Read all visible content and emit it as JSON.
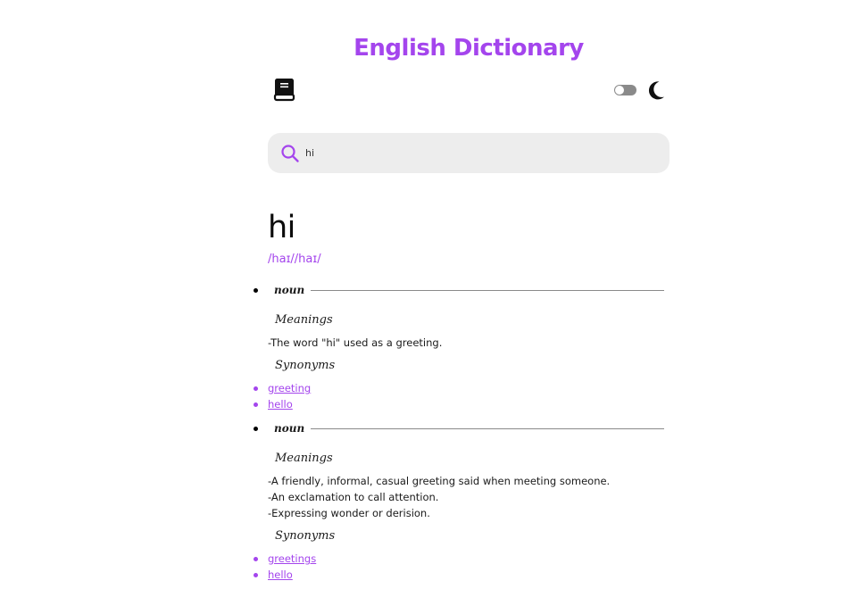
{
  "app": {
    "title": "English Dictionary"
  },
  "search": {
    "value": "hi",
    "icon": "search-icon"
  },
  "theme": {
    "toggle_on": false,
    "icon": "moon-icon"
  },
  "colors": {
    "accent": "#a445ed",
    "search_bg": "#ededed",
    "toggle_off": "#8a8a8a",
    "rule": "#8a8a8a",
    "text": "#1a1a1a"
  },
  "entry": {
    "word": "hi",
    "phonetic": "/haɪ//haɪ/",
    "meanings": [
      {
        "part_of_speech": "noun",
        "meanings_heading": "Meanings",
        "definitions": [
          "The word \"hi\" used as a greeting."
        ],
        "synonyms_heading": "Synonyms",
        "synonyms": [
          "greeting",
          "hello"
        ]
      },
      {
        "part_of_speech": "noun",
        "meanings_heading": "Meanings",
        "definitions": [
          "A friendly, informal, casual greeting said when meeting someone.",
          "An exclamation to call attention.",
          "Expressing wonder or derision."
        ],
        "synonyms_heading": "Synonyms",
        "synonyms": [
          "greetings",
          "hello"
        ]
      }
    ]
  }
}
